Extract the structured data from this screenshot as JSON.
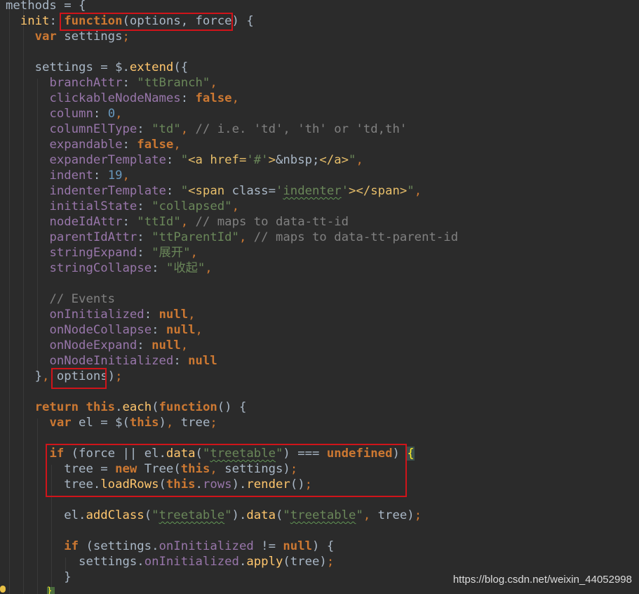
{
  "code_lines": [
    [
      [
        "t",
        "methods = {"
      ]
    ],
    [
      [
        "t",
        "  "
      ],
      [
        "f",
        "init"
      ],
      [
        "t",
        ": "
      ],
      [
        "k",
        "function"
      ],
      [
        "t",
        "(options, force) {"
      ]
    ],
    [
      [
        "t",
        "    "
      ],
      [
        "k",
        "var"
      ],
      [
        "t",
        " settings"
      ],
      [
        "kn",
        ";"
      ]
    ],
    [],
    [
      [
        "t",
        "    settings = $."
      ],
      [
        "f",
        "extend"
      ],
      [
        "t",
        "({"
      ]
    ],
    [
      [
        "t",
        "      "
      ],
      [
        "p",
        "branchAttr"
      ],
      [
        "t",
        ": "
      ],
      [
        "s",
        "\"ttBranch\""
      ],
      [
        "kn",
        ","
      ]
    ],
    [
      [
        "t",
        "      "
      ],
      [
        "p",
        "clickableNodeNames"
      ],
      [
        "t",
        ": "
      ],
      [
        "k",
        "false"
      ],
      [
        "kn",
        ","
      ]
    ],
    [
      [
        "t",
        "      "
      ],
      [
        "p",
        "column"
      ],
      [
        "t",
        ": "
      ],
      [
        "n",
        "0"
      ],
      [
        "kn",
        ","
      ]
    ],
    [
      [
        "t",
        "      "
      ],
      [
        "p",
        "columnElType"
      ],
      [
        "t",
        ": "
      ],
      [
        "s",
        "\"td\""
      ],
      [
        "kn",
        ","
      ],
      [
        "c",
        " // i.e. 'td', 'th' or 'td,th'"
      ]
    ],
    [
      [
        "t",
        "      "
      ],
      [
        "p",
        "expandable"
      ],
      [
        "t",
        ": "
      ],
      [
        "k",
        "false"
      ],
      [
        "kn",
        ","
      ]
    ],
    [
      [
        "t",
        "      "
      ],
      [
        "p",
        "expanderTemplate"
      ],
      [
        "t",
        ": "
      ],
      [
        "s",
        "\""
      ],
      [
        "y",
        "<a href="
      ],
      [
        "s",
        "'#'"
      ],
      [
        "y",
        ">"
      ],
      [
        "t",
        "&nbsp;"
      ],
      [
        "y",
        "</a>"
      ],
      [
        "s",
        "\""
      ],
      [
        "kn",
        ","
      ]
    ],
    [
      [
        "t",
        "      "
      ],
      [
        "p",
        "indent"
      ],
      [
        "t",
        ": "
      ],
      [
        "n",
        "19"
      ],
      [
        "kn",
        ","
      ]
    ],
    [
      [
        "t",
        "      "
      ],
      [
        "p",
        "indenterTemplate"
      ],
      [
        "t",
        ": "
      ],
      [
        "s",
        "\""
      ],
      [
        "y",
        "<span "
      ],
      [
        "t",
        "class="
      ],
      [
        "s",
        "'"
      ],
      [
        "su",
        "indenter"
      ],
      [
        "s",
        "'"
      ],
      [
        "y",
        ">"
      ],
      [
        "y",
        "</span>"
      ],
      [
        "s",
        "\""
      ],
      [
        "kn",
        ","
      ]
    ],
    [
      [
        "t",
        "      "
      ],
      [
        "p",
        "initialState"
      ],
      [
        "t",
        ": "
      ],
      [
        "s",
        "\"collapsed\""
      ],
      [
        "kn",
        ","
      ]
    ],
    [
      [
        "t",
        "      "
      ],
      [
        "p",
        "nodeIdAttr"
      ],
      [
        "t",
        ": "
      ],
      [
        "s",
        "\"ttId\""
      ],
      [
        "kn",
        ","
      ],
      [
        "c",
        " // maps to data-tt-id"
      ]
    ],
    [
      [
        "t",
        "      "
      ],
      [
        "p",
        "parentIdAttr"
      ],
      [
        "t",
        ": "
      ],
      [
        "s",
        "\"ttParentId\""
      ],
      [
        "kn",
        ","
      ],
      [
        "c",
        " // maps to data-tt-parent-id"
      ]
    ],
    [
      [
        "t",
        "      "
      ],
      [
        "p",
        "stringExpand"
      ],
      [
        "t",
        ": "
      ],
      [
        "s",
        "\"展开\""
      ],
      [
        "kn",
        ","
      ]
    ],
    [
      [
        "t",
        "      "
      ],
      [
        "p",
        "stringCollapse"
      ],
      [
        "t",
        ": "
      ],
      [
        "s",
        "\"收起\""
      ],
      [
        "kn",
        ","
      ]
    ],
    [],
    [
      [
        "t",
        "      "
      ],
      [
        "c",
        "// Events"
      ]
    ],
    [
      [
        "t",
        "      "
      ],
      [
        "p",
        "onInitialized"
      ],
      [
        "t",
        ": "
      ],
      [
        "k",
        "null"
      ],
      [
        "kn",
        ","
      ]
    ],
    [
      [
        "t",
        "      "
      ],
      [
        "p",
        "onNodeCollapse"
      ],
      [
        "t",
        ": "
      ],
      [
        "k",
        "null"
      ],
      [
        "kn",
        ","
      ]
    ],
    [
      [
        "t",
        "      "
      ],
      [
        "p",
        "onNodeExpand"
      ],
      [
        "t",
        ": "
      ],
      [
        "k",
        "null"
      ],
      [
        "kn",
        ","
      ]
    ],
    [
      [
        "t",
        "      "
      ],
      [
        "p",
        "onNodeInitialized"
      ],
      [
        "t",
        ": "
      ],
      [
        "k",
        "null"
      ]
    ],
    [
      [
        "t",
        "    }"
      ],
      [
        "kn",
        ","
      ],
      [
        "t",
        " options)"
      ],
      [
        "kn",
        ";"
      ]
    ],
    [],
    [
      [
        "t",
        "    "
      ],
      [
        "k",
        "return"
      ],
      [
        "t",
        " "
      ],
      [
        "k",
        "this"
      ],
      [
        "t",
        "."
      ],
      [
        "f",
        "each"
      ],
      [
        "t",
        "("
      ],
      [
        "k",
        "function"
      ],
      [
        "t",
        "() {"
      ]
    ],
    [
      [
        "t",
        "      "
      ],
      [
        "k",
        "var"
      ],
      [
        "t",
        " el = $("
      ],
      [
        "k",
        "this"
      ],
      [
        "t",
        ")"
      ],
      [
        "kn",
        ","
      ],
      [
        "t",
        " tree"
      ],
      [
        "kn",
        ";"
      ]
    ],
    [],
    [
      [
        "t",
        "      "
      ],
      [
        "k",
        "if"
      ],
      [
        "t",
        " (force || el."
      ],
      [
        "f",
        "data"
      ],
      [
        "t",
        "("
      ],
      [
        "s",
        "\""
      ],
      [
        "su",
        "treetable"
      ],
      [
        "s",
        "\""
      ],
      [
        "t",
        ") === "
      ],
      [
        "k",
        "undefined"
      ],
      [
        "t",
        ") "
      ],
      [
        "br",
        "{"
      ]
    ],
    [
      [
        "t",
        "        tree = "
      ],
      [
        "k",
        "new"
      ],
      [
        "t",
        " Tree("
      ],
      [
        "k",
        "this"
      ],
      [
        "kn",
        ","
      ],
      [
        "t",
        " settings)"
      ],
      [
        "kn",
        ";"
      ]
    ],
    [
      [
        "t",
        "        tree."
      ],
      [
        "f",
        "loadRows"
      ],
      [
        "t",
        "("
      ],
      [
        "k",
        "this"
      ],
      [
        "t",
        "."
      ],
      [
        "p",
        "rows"
      ],
      [
        "t",
        ")."
      ],
      [
        "f",
        "render"
      ],
      [
        "t",
        "()"
      ],
      [
        "kn",
        ";"
      ]
    ],
    [],
    [
      [
        "t",
        "        el."
      ],
      [
        "f",
        "addClass"
      ],
      [
        "t",
        "("
      ],
      [
        "s",
        "\""
      ],
      [
        "su",
        "treetable"
      ],
      [
        "s",
        "\""
      ],
      [
        "t",
        ")."
      ],
      [
        "f",
        "data"
      ],
      [
        "t",
        "("
      ],
      [
        "s",
        "\""
      ],
      [
        "su",
        "treetable"
      ],
      [
        "s",
        "\""
      ],
      [
        "kn",
        ","
      ],
      [
        "t",
        " tree)"
      ],
      [
        "kn",
        ";"
      ]
    ],
    [],
    [
      [
        "t",
        "        "
      ],
      [
        "k",
        "if"
      ],
      [
        "t",
        " (settings."
      ],
      [
        "p",
        "onInitialized"
      ],
      [
        "t",
        " != "
      ],
      [
        "k",
        "null"
      ],
      [
        "t",
        ") {"
      ]
    ],
    [
      [
        "t",
        "          settings."
      ],
      [
        "p",
        "onInitialized"
      ],
      [
        "t",
        "."
      ],
      [
        "f",
        "apply"
      ],
      [
        "t",
        "(tree)"
      ],
      [
        "kn",
        ";"
      ]
    ],
    [
      [
        "t",
        "        }"
      ]
    ],
    [
      [
        "t",
        "      "
      ]
    ]
  ],
  "watermark": "https://blog.csdn.net/weixin_44052998",
  "cursor_glyph": "}",
  "colors": {
    "background": "#2b2b2b",
    "annotation_box": "#d0141a",
    "keyword": "#cc7832",
    "property": "#9876aa",
    "string": "#6a8759",
    "number": "#6897bb",
    "comment": "#808080",
    "function": "#ffc66d",
    "text": "#a9b7c6"
  }
}
